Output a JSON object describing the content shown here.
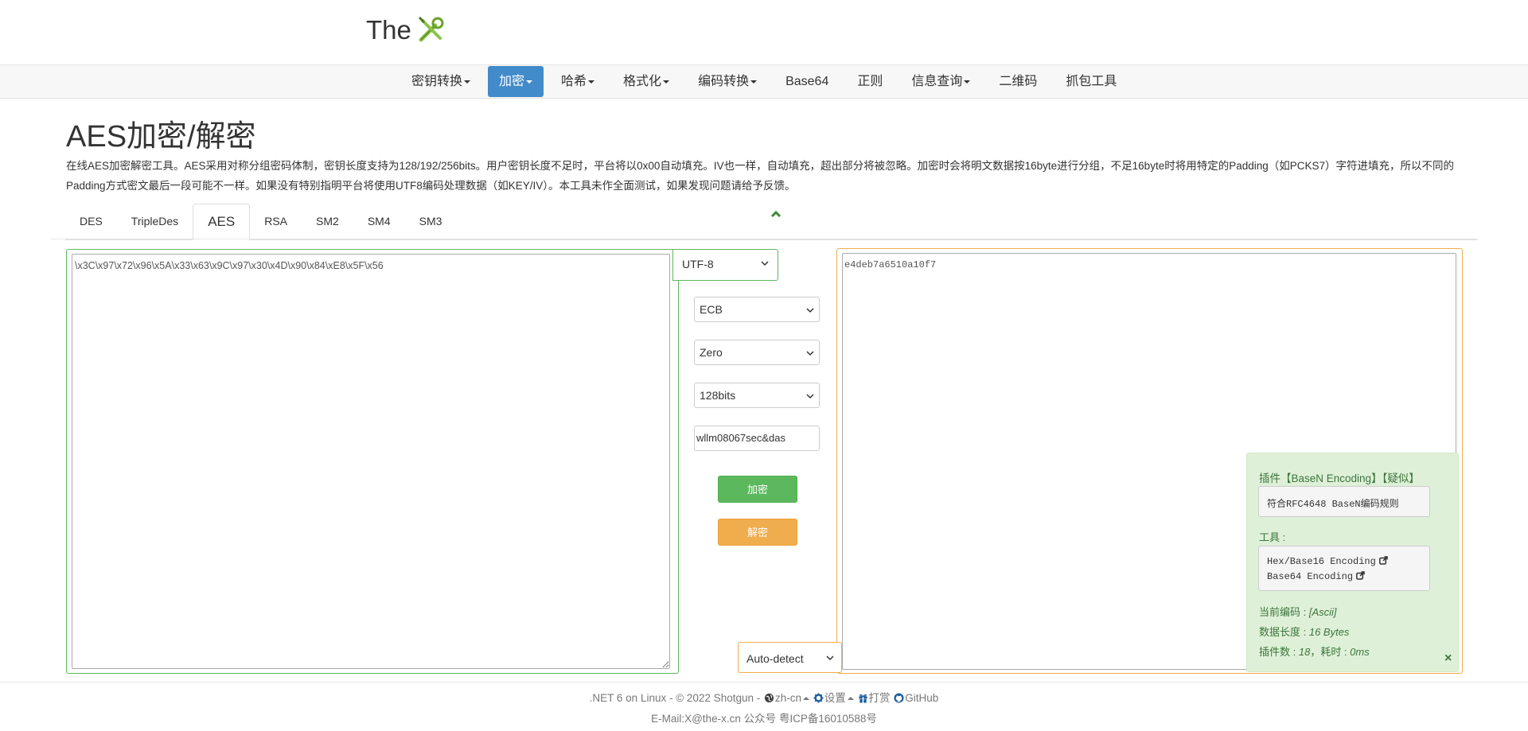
{
  "brand": {
    "text": "The"
  },
  "nav": {
    "items": [
      {
        "label": "密钥转换",
        "dropdown": true
      },
      {
        "label": "加密",
        "dropdown": true,
        "active": true
      },
      {
        "label": "哈希",
        "dropdown": true
      },
      {
        "label": "格式化",
        "dropdown": true
      },
      {
        "label": "编码转换",
        "dropdown": true
      },
      {
        "label": "Base64",
        "dropdown": false
      },
      {
        "label": "正则",
        "dropdown": false
      },
      {
        "label": "信息查询",
        "dropdown": true
      },
      {
        "label": "二维码",
        "dropdown": false
      },
      {
        "label": "抓包工具",
        "dropdown": false
      }
    ]
  },
  "page": {
    "title": "AES加密/解密",
    "description": "在线AES加密解密工具。AES采用对称分组密码体制，密钥长度支持为128/192/256bits。用户密钥长度不足时，平台将以0x00自动填充。IV也一样，自动填充，超出部分将被忽略。加密时会将明文数据按16byte进行分组，不足16byte时将用特定的Padding（如PCKS7）字符进填充，所以不同的Padding方式密文最后一段可能不一样。如果没有特别指明平台将使用UTF8编码处理数据（如KEY/IV）。本工具未作全面测试，如果发现问题请给予反馈。"
  },
  "tabs": [
    "DES",
    "TripleDes",
    "AES",
    "RSA",
    "SM2",
    "SM4",
    "SM3"
  ],
  "active_tab": "AES",
  "input": {
    "text": "\\x3C\\x97\\x72\\x96\\x5A\\x33\\x63\\x9C\\x97\\x30\\x4D\\x90\\x84\\xE8\\x5F\\x56",
    "encoding": "UTF-8"
  },
  "controls": {
    "mode": "ECB",
    "padding": "Zero",
    "key_size": "128bits",
    "key": "wllm08067sec&das",
    "encrypt_label": "加密",
    "decrypt_label": "解密"
  },
  "output": {
    "text": "e4deb7a6510a10f7",
    "encoding": "Auto-detect"
  },
  "plugin": {
    "title": "插件【BaseN Encoding】【疑似】",
    "rule": "符合RFC4648 BaseN编码规则",
    "tools_label": "工具 :",
    "tools": [
      "Hex/Base16 Encoding",
      "Base64 Encoding"
    ],
    "current_encoding_label": "当前编码 : ",
    "current_encoding": "[Ascii]",
    "data_length_label": "数据长度 : ",
    "data_length": "16 Bytes",
    "plugin_count_label": "插件数 : ",
    "plugin_count": "18",
    "time_label": "，耗时 : ",
    "time": "0ms",
    "close": "×"
  },
  "footer": {
    "platform": ".NET 6 on Linux - © 2022 Shotgun - ",
    "lang": "zh-cn",
    "settings": "设置",
    "donate": "打赏",
    "github": "GitHub",
    "contact": "E-Mail:X@the-x.cn 公众号 粤ICP备16010588号"
  },
  "colors": {
    "nav_active": "#428bca",
    "success": "#5cb85c",
    "warning": "#f0ad4e",
    "plugin_bg": "#dff0d8",
    "plugin_text": "#3c763d"
  }
}
